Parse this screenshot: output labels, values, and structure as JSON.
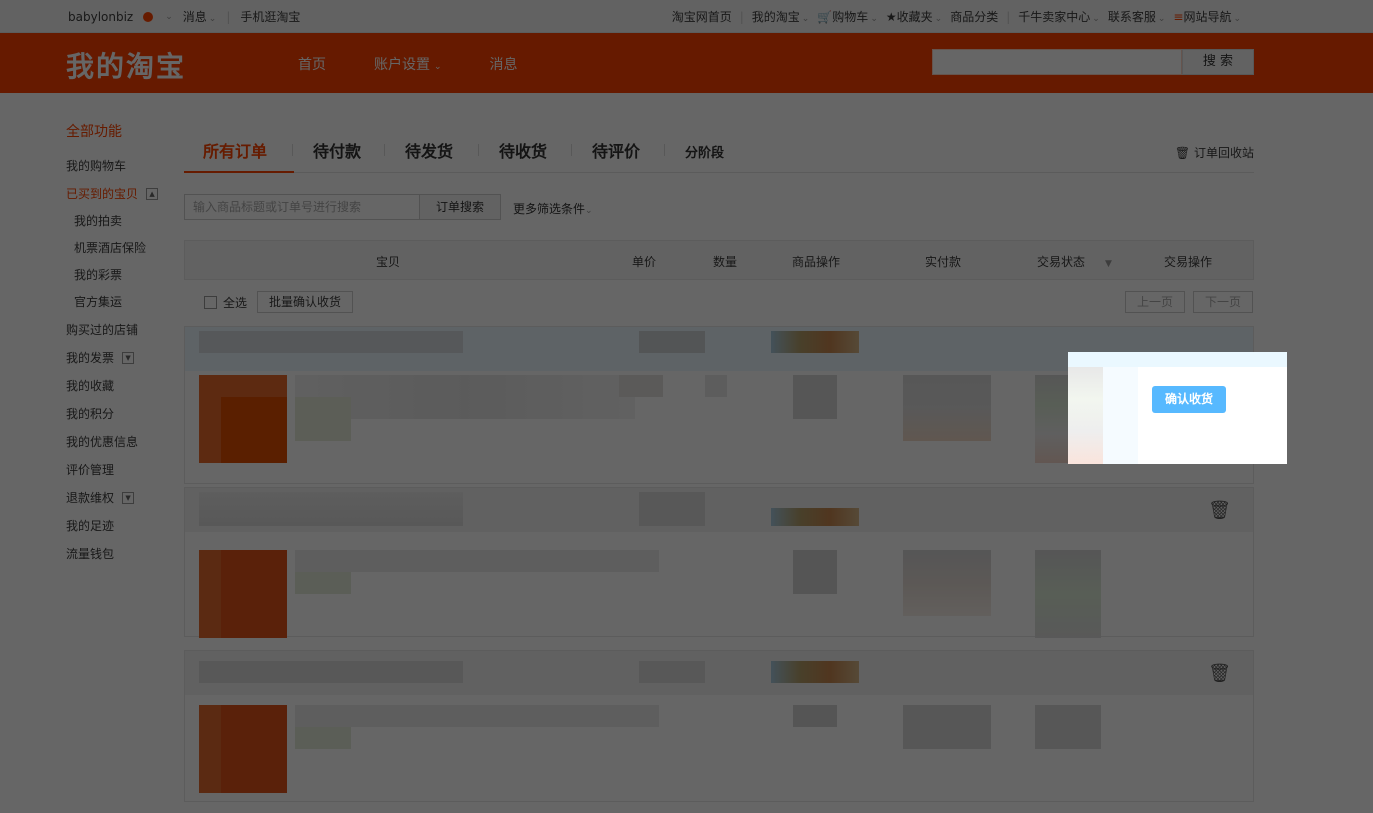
{
  "topbar": {
    "username": "babylonbiz",
    "message": "消息",
    "mobile": "手机逛淘宝",
    "links": [
      "淘宝网首页",
      "我的淘宝",
      "购物车",
      "收藏夹",
      "商品分类",
      "千牛卖家中心",
      "联系客服",
      "网站导航"
    ]
  },
  "header": {
    "logo": "我的淘宝",
    "nav": [
      "首页",
      "账户设置",
      "消息"
    ],
    "search_button": "搜 索"
  },
  "sidebar": {
    "title": "全部功能",
    "items": [
      "我的购物车",
      "已买到的宝贝",
      "我的拍卖",
      "机票酒店保险",
      "我的彩票",
      "官方集运",
      "购买过的店铺",
      "我的发票",
      "我的收藏",
      "我的积分",
      "我的优惠信息",
      "评价管理",
      "退款维权",
      "我的足迹",
      "流量钱包"
    ]
  },
  "tabs": {
    "items": [
      "所有订单",
      "待付款",
      "待发货",
      "待收货",
      "待评价",
      "分阶段"
    ],
    "recycle": "订单回收站"
  },
  "order_search": {
    "placeholder": "输入商品标题或订单号进行搜索",
    "button": "订单搜索",
    "more": "更多筛选条件"
  },
  "table_header": [
    "宝贝",
    "单价",
    "数量",
    "商品操作",
    "实付款",
    "交易状态",
    "交易操作"
  ],
  "toolbar": {
    "select_all": "全选",
    "batch_confirm": "批量确认收货",
    "prev_page": "上一页",
    "next_page": "下一页"
  },
  "highlight": {
    "confirm_button": "确认收货"
  },
  "colors": {
    "brand": "#ff4200",
    "confirm": "#57b9ff"
  }
}
